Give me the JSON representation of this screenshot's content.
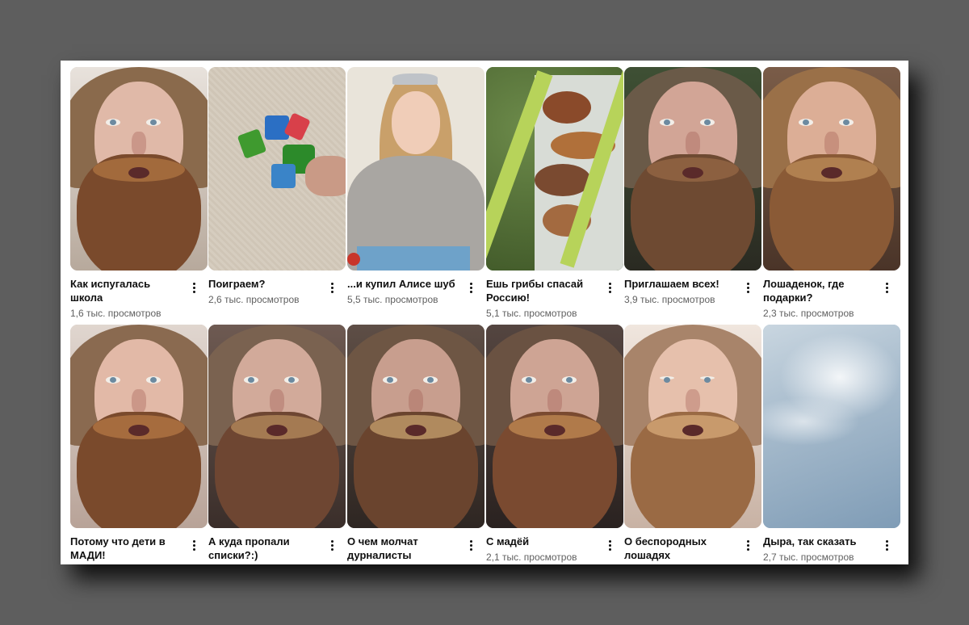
{
  "videos": [
    {
      "title": "Как испугалась школа",
      "views": "1,6 тыс. просмотров",
      "thumb": "bearded-man-face"
    },
    {
      "title": "Поиграем?",
      "views": "2,6 тыс. просмотров",
      "thumb": "toy-figures"
    },
    {
      "title": "...и купил Алисе шуб",
      "views": "5,5 тыс. просмотров",
      "thumb": "girl-fur-coat"
    },
    {
      "title": "Ешь грибы спасай Россию!",
      "views": "5,1 тыс. просмотров",
      "thumb": "mushrooms"
    },
    {
      "title": "Приглашаем всех!",
      "views": "3,9 тыс. просмотров",
      "thumb": "bearded-man-face"
    },
    {
      "title": "Лошаденок, где подарки?",
      "views": "2,3 тыс. просмотров",
      "thumb": "bearded-man-face"
    },
    {
      "title": "Потому что дети в МАДИ!",
      "views": "",
      "thumb": "bearded-man-face"
    },
    {
      "title": "А куда пропали списки?:)",
      "views": "",
      "thumb": "bearded-man-face"
    },
    {
      "title": "О чем молчат дурналисты",
      "views": "",
      "thumb": "bearded-man-face"
    },
    {
      "title": "С мадёй",
      "views": "2,1 тыс. просмотров",
      "thumb": "bearded-man-face"
    },
    {
      "title": "О беспородных лошадях",
      "views": "",
      "thumb": "bearded-man-face"
    },
    {
      "title": "Дыра, так сказать",
      "views": "2,7 тыс. просмотров",
      "thumb": "cloudy-sky"
    }
  ],
  "colors": {
    "page_background": "#5e5e5e",
    "panel_background": "#ffffff",
    "title_text": "#0f0f0f",
    "meta_text": "#606060"
  }
}
